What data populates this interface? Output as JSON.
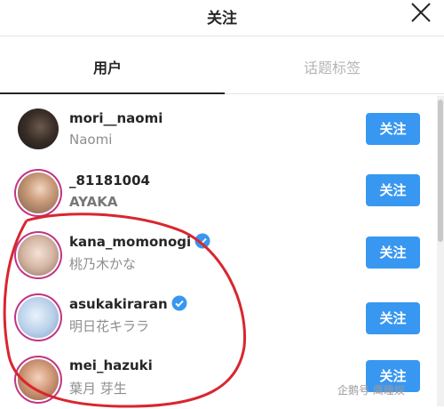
{
  "header": {
    "title": "关注",
    "close_icon": "close-icon"
  },
  "tabs": [
    {
      "label": "用户",
      "active": true
    },
    {
      "label": "话题标签",
      "active": false
    }
  ],
  "accent_color": "#3897f0",
  "users": [
    {
      "username": "mori__naomi",
      "display_name": "Naomi",
      "verified": false,
      "follow_label": "关注"
    },
    {
      "username": "_81181004",
      "display_name": "AYAKA",
      "verified": false,
      "follow_label": "关注"
    },
    {
      "username": "kana_momonogi",
      "display_name": "桃乃木かな",
      "verified": true,
      "follow_label": "关注"
    },
    {
      "username": "asukakiraran",
      "display_name": "明日花キララ",
      "verified": true,
      "follow_label": "关注"
    },
    {
      "username": "mei_hazuki",
      "display_name": "葉月 芽生",
      "verified": false,
      "follow_label": "关注"
    }
  ],
  "watermark": "企鹅号 鹰瞳娱"
}
